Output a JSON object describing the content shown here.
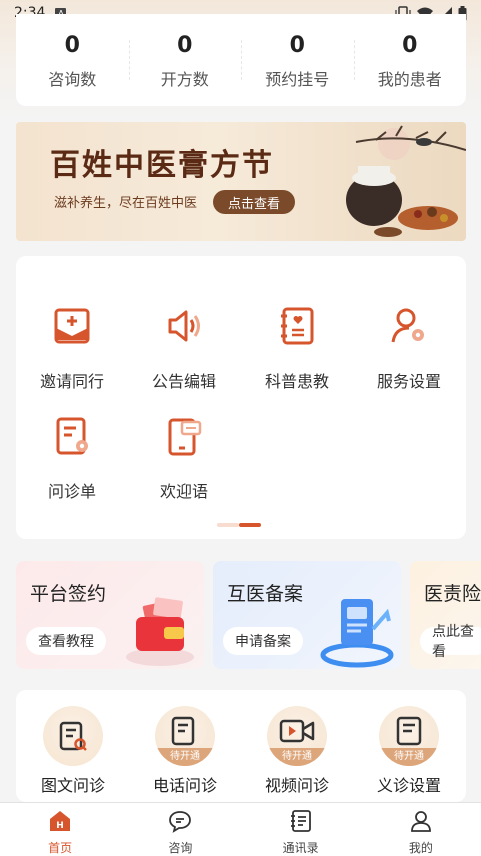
{
  "status_bar": {
    "time": "2:34",
    "notif": "A"
  },
  "stats": [
    {
      "value": "0",
      "label": "咨询数"
    },
    {
      "value": "0",
      "label": "开方数"
    },
    {
      "value": "0",
      "label": "预约挂号"
    },
    {
      "value": "0",
      "label": "我的患者"
    }
  ],
  "banner": {
    "title": "百姓中医膏方节",
    "subtitle": "滋补养生，尽在百姓中医",
    "button": "点击查看"
  },
  "functions": [
    {
      "label": "邀请同行",
      "icon": "envelope-plus-icon"
    },
    {
      "label": "公告编辑",
      "icon": "speaker-icon"
    },
    {
      "label": "科普患教",
      "icon": "notebook-heart-icon"
    },
    {
      "label": "服务设置",
      "icon": "user-gear-icon"
    },
    {
      "label": "问诊单",
      "icon": "form-gear-icon"
    },
    {
      "label": "欢迎语",
      "icon": "phone-message-icon"
    }
  ],
  "promos": [
    {
      "title": "平台签约",
      "button": "查看教程"
    },
    {
      "title": "互医备案",
      "button": "申请备案"
    },
    {
      "title": "医责险",
      "button": "点此查看"
    }
  ],
  "consult": [
    {
      "label": "图文问诊",
      "badge": ""
    },
    {
      "label": "电话问诊",
      "badge": "待开通"
    },
    {
      "label": "视频问诊",
      "badge": "待开通"
    },
    {
      "label": "义诊设置",
      "badge": "待开通"
    }
  ],
  "tabs": [
    {
      "label": "首页",
      "icon": "home-icon"
    },
    {
      "label": "咨询",
      "icon": "chat-icon"
    },
    {
      "label": "通讯录",
      "icon": "contacts-icon"
    },
    {
      "label": "我的",
      "icon": "profile-icon"
    }
  ],
  "colors": {
    "accent": "#d7552c",
    "banner_brown": "#7a4a2b",
    "badge": "#dca57a"
  }
}
